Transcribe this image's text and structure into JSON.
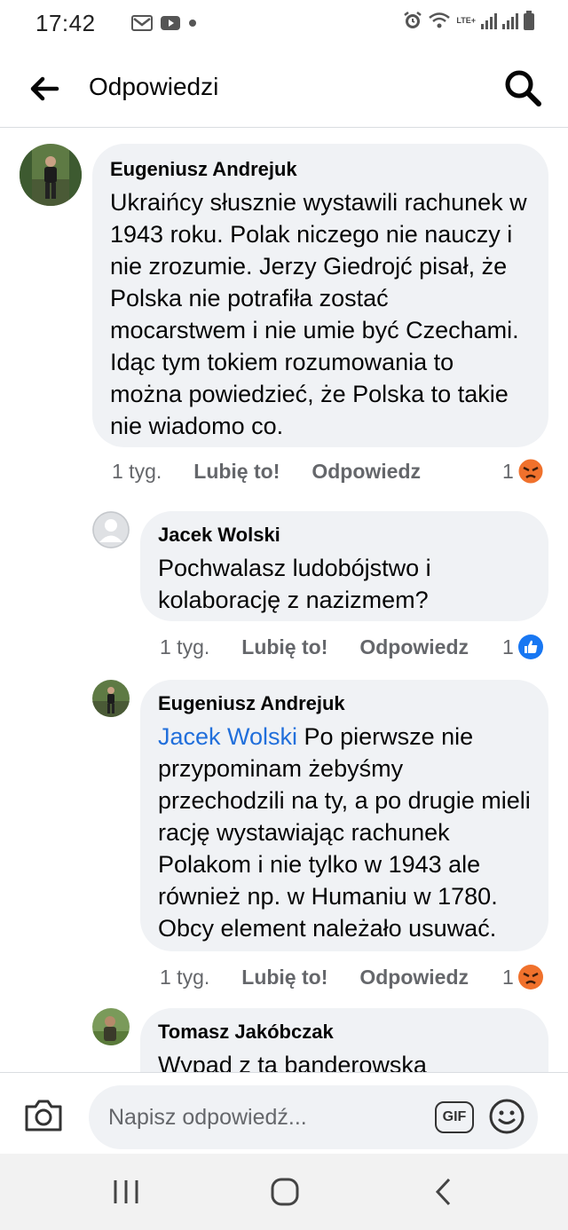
{
  "status_bar": {
    "time": "17:42",
    "network": "LTE+",
    "icons": [
      "gmail-icon",
      "youtube-icon",
      "dot-icon",
      "alarm-icon",
      "wifi-icon",
      "signal-icon",
      "battery-icon"
    ]
  },
  "header": {
    "title": "Odpowiedzi",
    "back_icon": "arrow-left-icon",
    "search_icon": "search-icon"
  },
  "comments": [
    {
      "author": "Eugeniusz Andrejuk",
      "text": "Ukraińcy słusznie wystawili rachunek w 1943 roku. Polak niczego nie nauczy i nie zrozumie. Jerzy Giedrojć pisał, że Polska nie potrafiła zostać mocarstwem i nie umie być Czechami. Idąc tym tokiem rozumowania to można powiedzieć, że Polska to takie nie wiadomo co.",
      "time": "1 tyg.",
      "like": "Lubię to!",
      "reply": "Odpowiedz",
      "reaction_count": "1",
      "reaction": "angry"
    },
    {
      "author": "Jacek Wolski",
      "text": "Pochwalasz ludobójstwo i kolaborację z nazizmem?",
      "time": "1 tyg.",
      "like": "Lubię to!",
      "reply": "Odpowiedz",
      "reaction_count": "1",
      "reaction": "like"
    },
    {
      "author": "Eugeniusz Andrejuk",
      "mention": "Jacek Wolski",
      "text": " Po pierwsze nie przypominam żebyśmy przechodzili na ty, a po drugie mieli rację wystawiając rachunek Polakom i nie tylko w 1943 ale również np. w Humaniu w 1780. Obcy element należało usuwać.",
      "time": "1 tyg.",
      "like": "Lubię to!",
      "reply": "Odpowiedz",
      "reaction_count": "1",
      "reaction": "angry"
    },
    {
      "author": "Tomasz Jakóbczak",
      "text": "Wypad z tą banderowską"
    }
  ],
  "composer": {
    "placeholder": "Napisz odpowiedź...",
    "gif_label": "GIF"
  },
  "colors": {
    "bubble": "#f0f2f5",
    "mention": "#216fdb",
    "meta": "#65676b",
    "like_blue": "#1877f2",
    "angry_orange": "#f0712c"
  }
}
